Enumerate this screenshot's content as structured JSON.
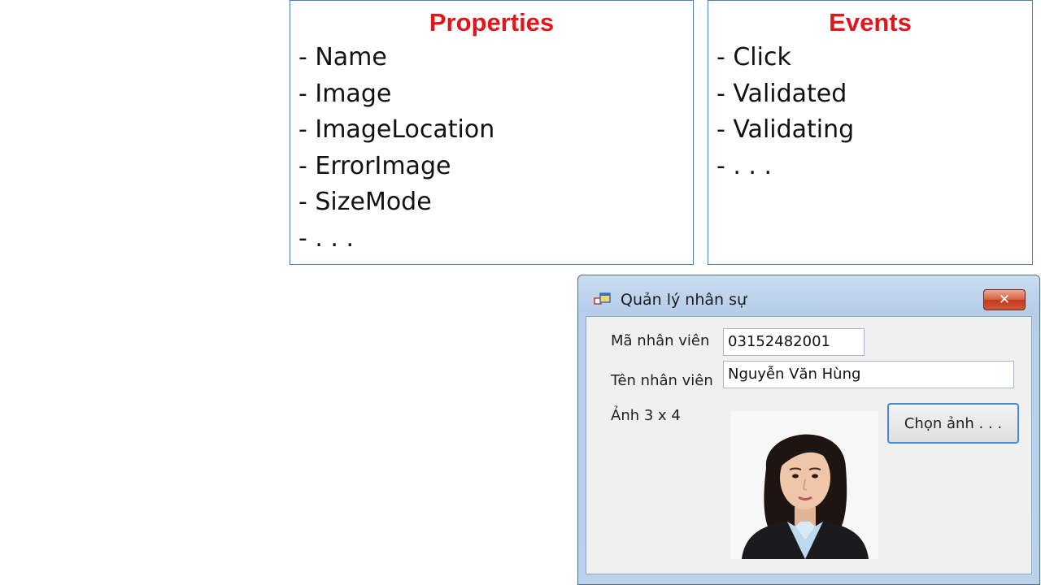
{
  "properties": {
    "title": "Properties",
    "items": [
      "- Name",
      "- Image",
      "- ImageLocation",
      "- ErrorImage",
      "- SizeMode",
      "- . . ."
    ]
  },
  "events": {
    "title": "Events",
    "items": [
      "- Click",
      "- Validated",
      "- Validating",
      "- . . ."
    ]
  },
  "form": {
    "title": "Quản lý nhân sự",
    "close_label": "✕",
    "employee_id_label": "Mã nhân viên",
    "employee_id_value": "03152482001",
    "employee_name_label": "Tên nhân viên",
    "employee_name_value": "Nguyễn Văn Hùng",
    "photo_label": "Ảnh 3 x 4",
    "choose_photo_button": "Chọn ảnh . . ."
  },
  "colors": {
    "heading_red": "#e0161b",
    "panel_border": "#4a7ebb",
    "window_frame": "#bcd1ea",
    "close_button": "#c2381a",
    "button_focus_border": "#3d8ee0"
  },
  "icons": [
    "app-icon",
    "close-icon",
    "portrait-photo"
  ]
}
